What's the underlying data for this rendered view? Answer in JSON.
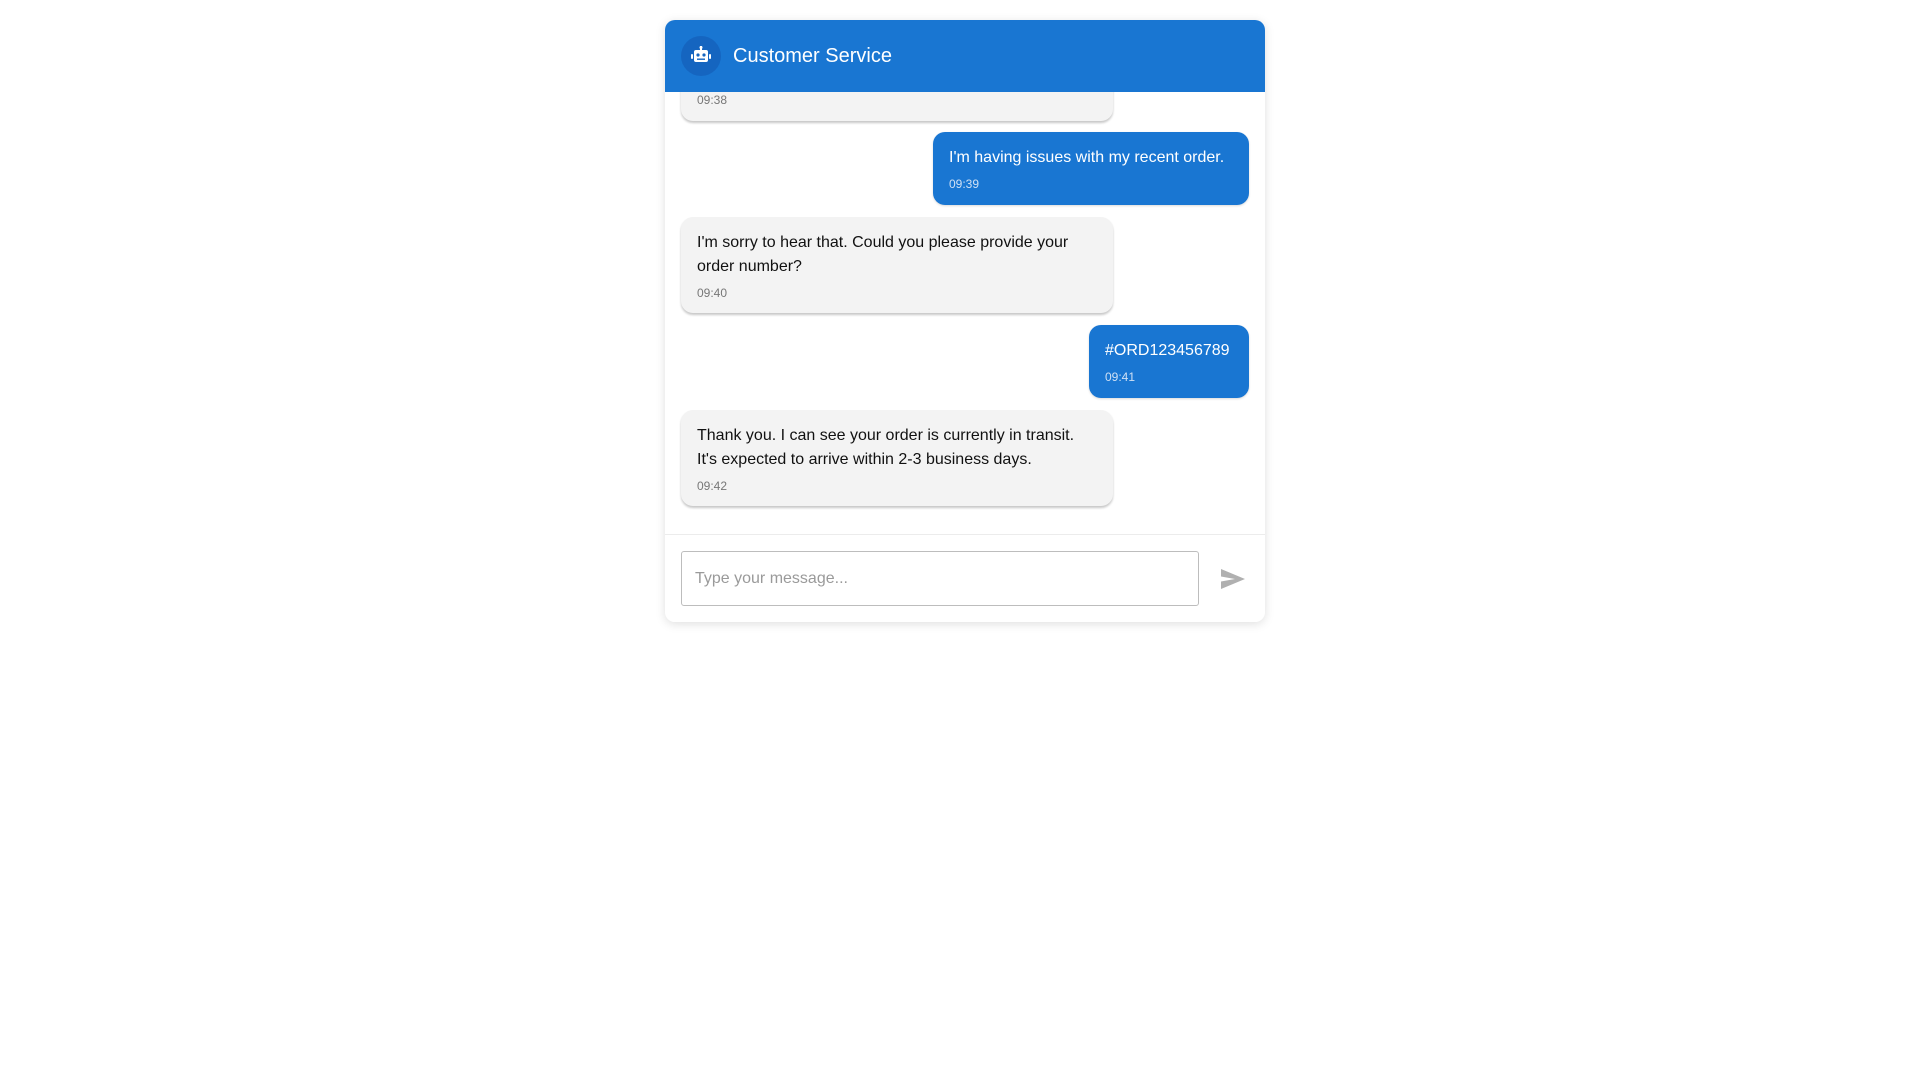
{
  "header": {
    "title": "Customer Service",
    "avatar_icon": "robot-icon",
    "background": "#1976d2"
  },
  "messages": [
    {
      "sender": "agent",
      "text": "",
      "time": "09:38"
    },
    {
      "sender": "user",
      "text": "I'm having issues with my recent order.",
      "time": "09:39"
    },
    {
      "sender": "agent",
      "text": "I'm sorry to hear that. Could you please provide your order number?",
      "time": "09:40"
    },
    {
      "sender": "user",
      "text": "#ORD123456789",
      "time": "09:41"
    },
    {
      "sender": "agent",
      "text": "Thank you. I can see your order is currently in transit. It's expected to arrive within 2-3 business days.",
      "time": "09:42"
    }
  ],
  "composer": {
    "placeholder": "Type your message...",
    "value": "",
    "send_icon": "send-icon"
  },
  "colors": {
    "accent": "#1976d2",
    "agent_bubble": "#f3f3f3"
  }
}
